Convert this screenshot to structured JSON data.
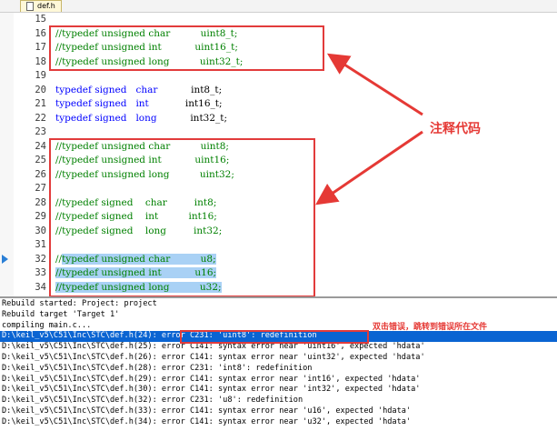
{
  "tab": {
    "label": "def.h"
  },
  "editor": {
    "lines": [
      {
        "n": "15",
        "parts": []
      },
      {
        "n": "16",
        "parts": [
          {
            "t": "//typedef unsigned char          uint8_t;",
            "c": "comment"
          }
        ]
      },
      {
        "n": "17",
        "parts": [
          {
            "t": "//typedef unsigned int           uint16_t;",
            "c": "comment"
          }
        ]
      },
      {
        "n": "18",
        "parts": [
          {
            "t": "//typedef unsigned long          uint32_t;",
            "c": "comment"
          }
        ]
      },
      {
        "n": "19",
        "parts": []
      },
      {
        "n": "20",
        "parts": [
          {
            "t": "typedef signed   ",
            "c": "kw"
          },
          {
            "t": "char",
            "c": "kw"
          },
          {
            "t": "           int8_t;",
            "c": "txt"
          }
        ]
      },
      {
        "n": "21",
        "parts": [
          {
            "t": "typedef signed   ",
            "c": "kw"
          },
          {
            "t": "int",
            "c": "kw"
          },
          {
            "t": "            int16_t;",
            "c": "txt"
          }
        ]
      },
      {
        "n": "22",
        "parts": [
          {
            "t": "typedef signed   ",
            "c": "kw"
          },
          {
            "t": "long",
            "c": "kw"
          },
          {
            "t": "           int32_t;",
            "c": "txt"
          }
        ]
      },
      {
        "n": "23",
        "parts": []
      },
      {
        "n": "24",
        "parts": [
          {
            "t": "//typedef unsigned char          uint8;",
            "c": "comment"
          }
        ]
      },
      {
        "n": "25",
        "parts": [
          {
            "t": "//typedef unsigned int           uint16;",
            "c": "comment"
          }
        ]
      },
      {
        "n": "26",
        "parts": [
          {
            "t": "//typedef unsigned long          uint32;",
            "c": "comment"
          }
        ]
      },
      {
        "n": "27",
        "parts": []
      },
      {
        "n": "28",
        "parts": [
          {
            "t": "//typedef signed    char         int8;",
            "c": "comment"
          }
        ]
      },
      {
        "n": "29",
        "parts": [
          {
            "t": "//typedef signed    int          int16;",
            "c": "comment"
          }
        ]
      },
      {
        "n": "30",
        "parts": [
          {
            "t": "//typedef signed    long         int32;",
            "c": "comment"
          }
        ]
      },
      {
        "n": "31",
        "parts": []
      },
      {
        "n": "32",
        "parts": [
          {
            "t": "//",
            "c": "comment"
          },
          {
            "t": "typedef unsigned char          u8;",
            "c": "comment",
            "sel": true
          }
        ]
      },
      {
        "n": "33",
        "parts": [
          {
            "t": "//typedef unsigned int           u16;",
            "c": "comment",
            "sel": true
          }
        ]
      },
      {
        "n": "34",
        "parts": [
          {
            "t": "//typedef unsigned long          u32;",
            "c": "comment",
            "sel": true
          }
        ]
      }
    ]
  },
  "annotations": {
    "comment_code": "注释代码",
    "double_click": "双击错误，跳转到错误所在文件"
  },
  "output": {
    "lines": [
      {
        "t": "Rebuild started: Project: project"
      },
      {
        "t": "Rebuild target 'Target 1'"
      },
      {
        "t": "compiling main.c..."
      },
      {
        "t": "D:\\keil_v5\\C51\\Inc\\STC\\def.h(24): error C231: 'uint8': redefinition",
        "hl": true
      },
      {
        "t": "D:\\keil_v5\\C51\\Inc\\STC\\def.h(25): error C141: syntax error near 'uint16', expected 'hdata'"
      },
      {
        "t": "D:\\keil_v5\\C51\\Inc\\STC\\def.h(26): error C141: syntax error near 'uint32', expected 'hdata'"
      },
      {
        "t": "D:\\keil_v5\\C51\\Inc\\STC\\def.h(28): error C231: 'int8': redefinition"
      },
      {
        "t": "D:\\keil_v5\\C51\\Inc\\STC\\def.h(29): error C141: syntax error near 'int16', expected 'hdata'"
      },
      {
        "t": "D:\\keil_v5\\C51\\Inc\\STC\\def.h(30): error C141: syntax error near 'int32', expected 'hdata'"
      },
      {
        "t": "D:\\keil_v5\\C51\\Inc\\STC\\def.h(32): error C231: 'u8': redefinition"
      },
      {
        "t": "D:\\keil_v5\\C51\\Inc\\STC\\def.h(33): error C141: syntax error near 'u16', expected 'hdata'"
      },
      {
        "t": "D:\\keil_v5\\C51\\Inc\\STC\\def.h(34): error C141: syntax error near 'u32', expected 'hdata'"
      }
    ]
  },
  "colors": {
    "comment": "#008000",
    "keyword": "#0000ff",
    "annotation": "#e53935",
    "selection": "#a9d1f5",
    "error_highlight": "#0a64d2"
  },
  "icons": {
    "tab": "file-icon",
    "gutter": "current-line-marker-icon"
  }
}
